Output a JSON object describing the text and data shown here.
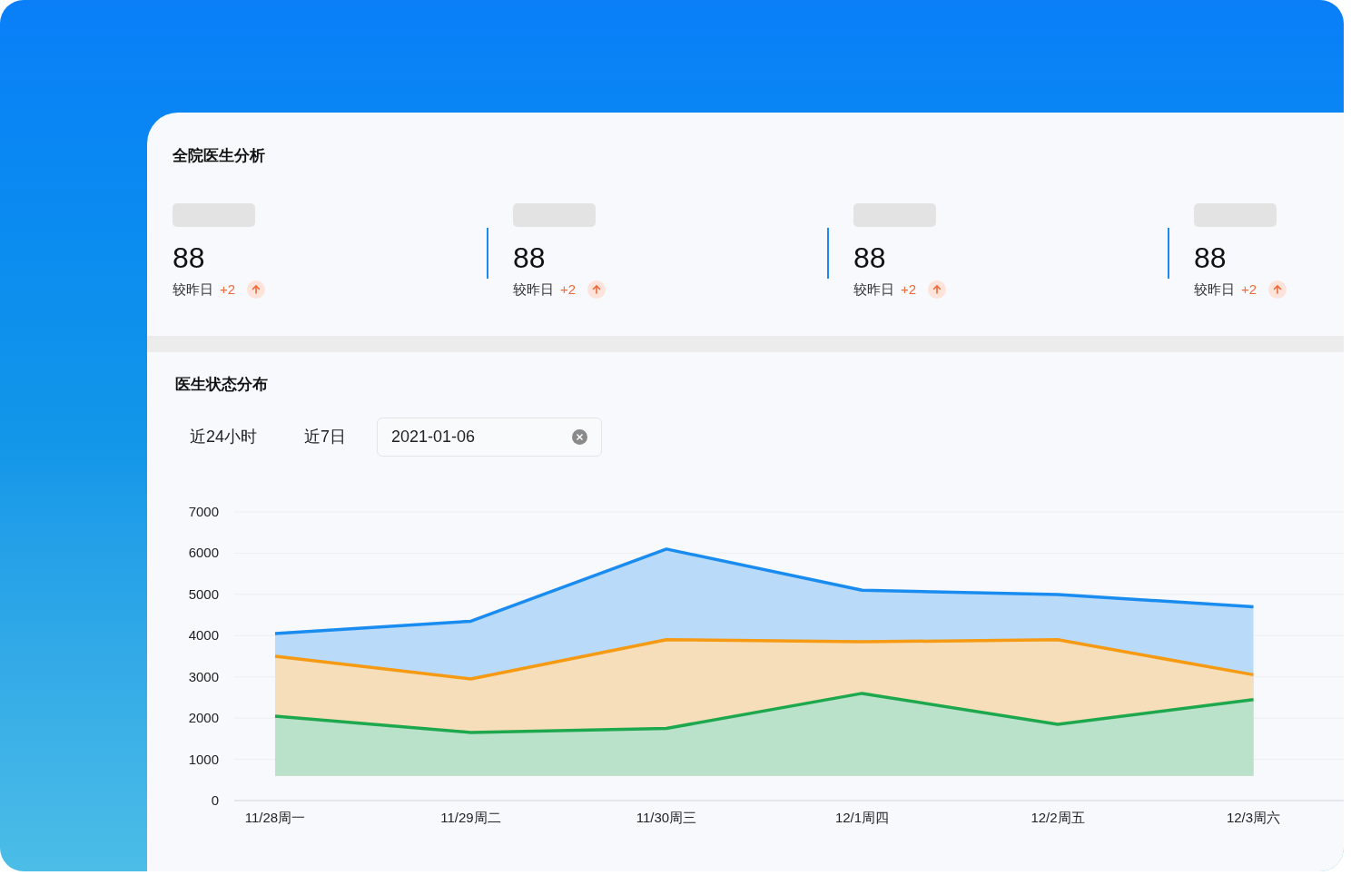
{
  "overview": {
    "title": "全院医生分析",
    "stats": [
      {
        "value": "88",
        "compare_label": "较昨日",
        "change": "+2"
      },
      {
        "value": "88",
        "compare_label": "较昨日",
        "change": "+2"
      },
      {
        "value": "88",
        "compare_label": "较昨日",
        "change": "+2"
      },
      {
        "value": "88",
        "compare_label": "较昨日",
        "change": "+2"
      }
    ]
  },
  "status": {
    "title": "医生状态分布",
    "ranges": [
      "近24小时",
      "近7日"
    ],
    "date_field": {
      "value": "2021-01-06"
    },
    "chart_data": {
      "type": "area",
      "categories": [
        "11/28周一",
        "11/29周二",
        "11/30周三",
        "12/1周四",
        "12/2周五",
        "12/3周六"
      ],
      "ylim": [
        0,
        7000
      ],
      "grid": true,
      "yticks": [
        0,
        1000,
        2000,
        3000,
        4000,
        5000,
        6000,
        7000
      ],
      "series": [
        {
          "color": "#1a8cf0",
          "values": [
            4050,
            4350,
            6100,
            5100,
            5000,
            4700
          ]
        },
        {
          "color": "#f59a12",
          "values": [
            3500,
            2950,
            3900,
            3850,
            3900,
            3050
          ]
        },
        {
          "color": "#1ea84e",
          "values": [
            2050,
            1650,
            1750,
            2600,
            1850,
            2450
          ]
        }
      ]
    }
  }
}
